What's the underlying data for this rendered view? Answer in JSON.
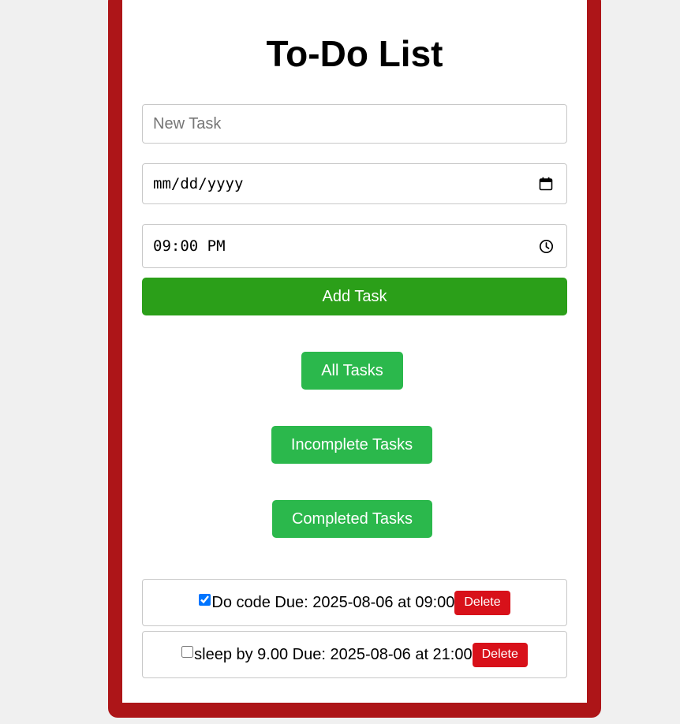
{
  "app": {
    "title": "To-Do List"
  },
  "form": {
    "task_placeholder": "New Task",
    "task_value": "",
    "date_value": "mm/dd/yyyy",
    "time_value": "09:00 PM",
    "add_label": "Add Task"
  },
  "filters": {
    "all_label": "All Tasks",
    "incomplete_label": "Incomplete Tasks",
    "completed_label": "Completed Tasks"
  },
  "tasks": [
    {
      "text": "Do code Due: 2025-08-06 at 09:00",
      "completed": true,
      "delete_label": "Delete"
    },
    {
      "text": "sleep by 9.00 Due: 2025-08-06 at 21:00",
      "completed": false,
      "delete_label": "Delete"
    }
  ],
  "icons": {
    "date": "calendar-icon",
    "time": "clock-icon"
  },
  "colors": {
    "frame": "#ad1518",
    "add_button": "#2b9f19",
    "filter_button": "#2bb84c",
    "delete_button": "#d8111a",
    "page_background": "#f0f0f0"
  }
}
